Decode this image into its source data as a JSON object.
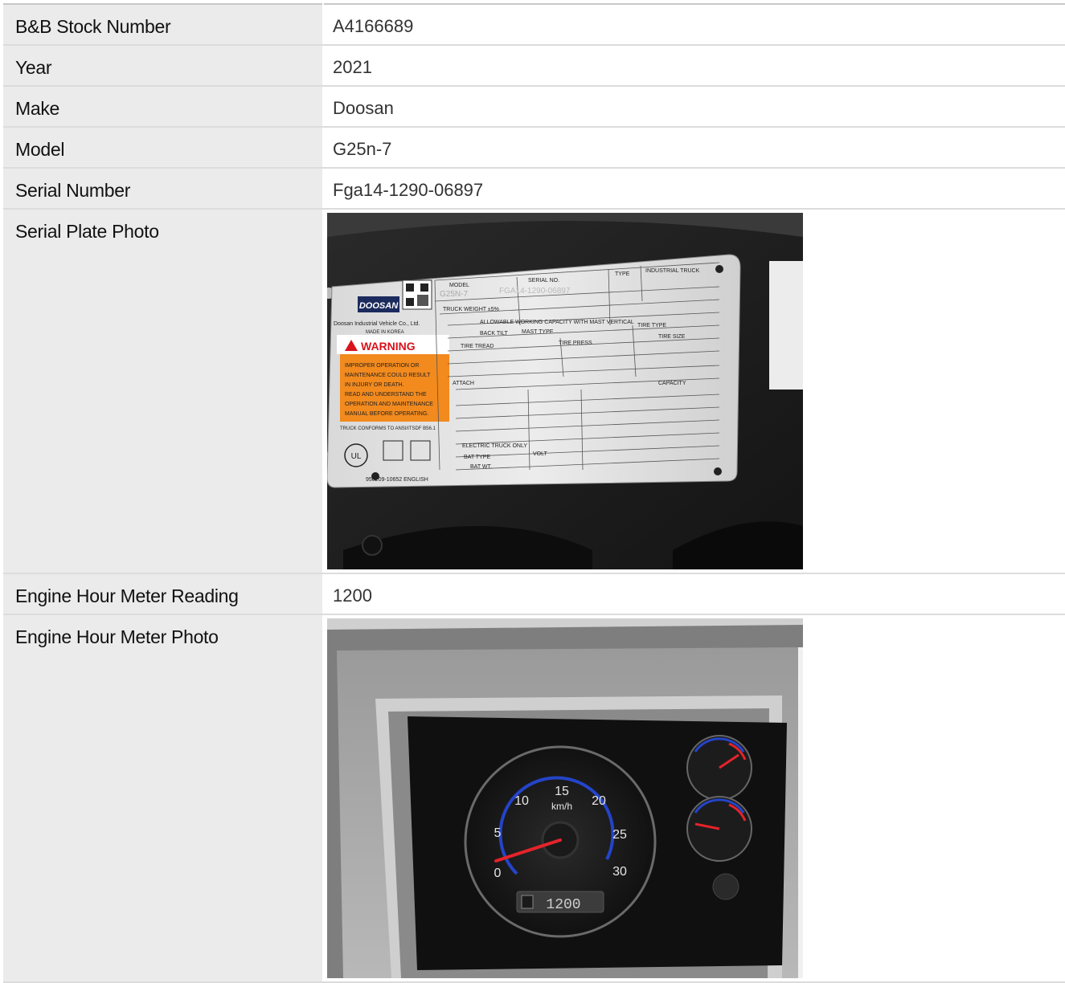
{
  "rows": [
    {
      "label": "B&B Stock Number",
      "value": "A4166689"
    },
    {
      "label": "Year",
      "value": "2021"
    },
    {
      "label": "Make",
      "value": "Doosan"
    },
    {
      "label": "Model",
      "value": "G25n-7"
    },
    {
      "label": "Serial Number",
      "value": "Fga14-1290-06897"
    },
    {
      "label": "Serial Plate Photo"
    },
    {
      "label": "Engine Hour Meter Reading",
      "value": "1200"
    },
    {
      "label": "Engine Hour Meter Photo"
    }
  ],
  "serial_plate": {
    "brand": "DOOSAN",
    "maker": "Doosan Industrial Vehicle Co., Ltd.",
    "made_in": "MADE IN KOREA",
    "warning_title": "WARNING",
    "warning_text": [
      "IMPROPER OPERATION OR",
      "MAINTENANCE COULD RESULT",
      "IN INJURY OR DEATH.",
      "READ AND UNDERSTAND THE",
      "OPERATION AND MAINTENANCE",
      "MANUAL BEFORE OPERATING."
    ],
    "conforms": "TRUCK CONFORMS TO ANSI/ITSDF B56.1",
    "part_no": "950209-10652 ENGLISH",
    "model_label": "MODEL",
    "model_value": "G25N-7",
    "serial_label": "SERIAL NO.",
    "serial_value": "FGA14-1290-06897",
    "type_label": "TYPE",
    "industrial_truck": "INDUSTRIAL TRUCK",
    "truck_weight": "TRUCK WEIGHT ±5%",
    "capacity_title": "ALLOWABLE WORKING CAPACITY WITH MAST VERTICAL",
    "back_tilt": "BACK TILT",
    "mast_type": "MAST TYPE",
    "tire_type": "TIRE TYPE",
    "tire_tread": "TIRE TREAD",
    "tire_press": "TIRE PRESS",
    "tire_size": "TIRE SIZE",
    "attach": "ATTACH",
    "capacity": "CAPACITY",
    "electric": "ELECTRIC TRUCK ONLY",
    "bat_type": "BAT TYPE",
    "bat_wt": "BAT WT.",
    "volt": "VOLT"
  },
  "hour_meter": {
    "speed_unit": "km/h",
    "ticks": [
      "0",
      "5",
      "10",
      "15",
      "20",
      "25",
      "30"
    ],
    "lcd_reading": "1200"
  },
  "colors": {
    "label_bg": "#ebebeb",
    "border": "#dcdcdc",
    "warning_orange": "#f28a1e"
  }
}
